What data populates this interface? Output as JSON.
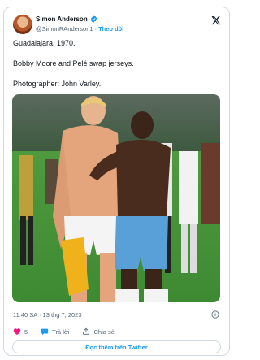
{
  "author": {
    "name": "Simon Anderson",
    "handle": "@SimonRAnderson1",
    "separator": "·",
    "follow_label": "Theo dõi",
    "verified_color": "#1d9bf0"
  },
  "tweet": {
    "lines": [
      "Guadalajara, 1970.",
      "Bobby Moore and Pelé swap jerseys.",
      "Photographer: John Varley."
    ],
    "timestamp": "11:40 SA · 13 thg 7, 2023"
  },
  "actions": {
    "like_count": "5",
    "reply_label": "Trả lời",
    "share_label": "Chia sẻ"
  },
  "read_more_label": "Đọc thêm trên Twitter",
  "icons": [
    "verified-badge-icon",
    "x-logo-icon",
    "info-icon",
    "heart-icon",
    "reply-icon",
    "share-icon"
  ],
  "colors": {
    "accent": "#1d9bf0",
    "like": "#f91880",
    "muted": "#536471"
  }
}
